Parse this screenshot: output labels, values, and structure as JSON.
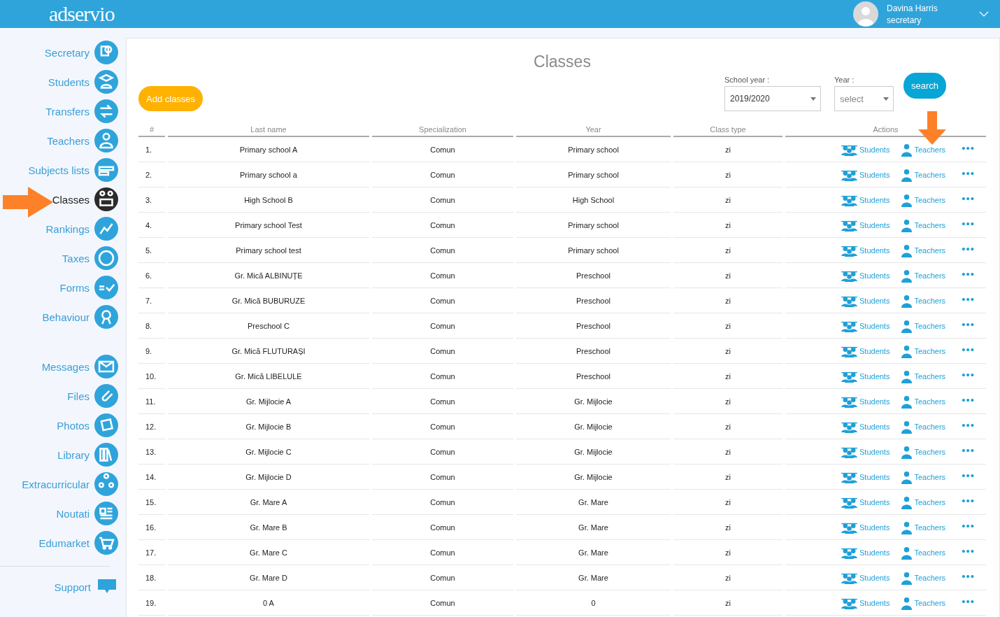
{
  "header": {
    "logo": "adservio",
    "user": {
      "name": "Davina Harris",
      "role": "secretary"
    }
  },
  "sidebar": {
    "groups": [
      [
        {
          "label": "Secretary",
          "selected": false
        },
        {
          "label": "Students",
          "selected": false
        },
        {
          "label": "Transfers",
          "selected": false
        },
        {
          "label": "Teachers",
          "selected": false
        },
        {
          "label": "Subjects lists",
          "selected": false
        },
        {
          "label": "Classes",
          "selected": true
        },
        {
          "label": "Rankings",
          "selected": false
        },
        {
          "label": "Taxes",
          "selected": false
        },
        {
          "label": "Forms",
          "selected": false
        },
        {
          "label": "Behaviour",
          "selected": false
        }
      ],
      [
        {
          "label": "Messages",
          "selected": false
        },
        {
          "label": "Files",
          "selected": false
        },
        {
          "label": "Photos",
          "selected": false
        },
        {
          "label": "Library",
          "selected": false
        },
        {
          "label": "Extracurricular",
          "selected": false
        },
        {
          "label": "Noutati",
          "selected": false
        },
        {
          "label": "Edumarket",
          "selected": false
        }
      ]
    ],
    "support": "Support"
  },
  "page": {
    "title": "Classes",
    "add_button": "Add classes",
    "filters": [
      {
        "label": "School year :",
        "value": "2019/2020"
      },
      {
        "label": "Year :",
        "placeholder": "select"
      }
    ],
    "search_button": "search"
  },
  "table": {
    "columns": [
      "#",
      "Last name",
      "Specialization",
      "Year",
      "Class type",
      "Actions"
    ],
    "rows": [
      {
        "cells": [
          "1.",
          "Primary school A",
          "Comun",
          "Primary school",
          "zi"
        ],
        "actions": [
          "Students",
          "Teachers",
          "•••"
        ]
      },
      {
        "cells": [
          "2.",
          "Primary school a",
          "Comun",
          "Primary school",
          "zi"
        ],
        "actions": [
          "Students",
          "Teachers",
          "•••"
        ]
      },
      {
        "cells": [
          "3.",
          "High School B",
          "Comun",
          "High School",
          "zi"
        ],
        "actions": [
          "Students",
          "Teachers",
          "•••"
        ]
      },
      {
        "cells": [
          "4.",
          "Primary school Test",
          "Comun",
          "Primary school",
          "zi"
        ],
        "actions": [
          "Students",
          "Teachers",
          "•••"
        ]
      },
      {
        "cells": [
          "5.",
          "Primary school test",
          "Comun",
          "Primary school",
          "zi"
        ],
        "actions": [
          "Students",
          "Teachers",
          "•••"
        ]
      },
      {
        "cells": [
          "6.",
          "Gr. Mică ALBINUȚE",
          "Comun",
          "Preschool",
          "zi"
        ],
        "actions": [
          "Students",
          "Teachers",
          "•••"
        ]
      },
      {
        "cells": [
          "7.",
          "Gr. Mică BUBURUZE",
          "Comun",
          "Preschool",
          "zi"
        ],
        "actions": [
          "Students",
          "Teachers",
          "•••"
        ]
      },
      {
        "cells": [
          "8.",
          "Preschool C",
          "Comun",
          "Preschool",
          "zi"
        ],
        "actions": [
          "Students",
          "Teachers",
          "•••"
        ]
      },
      {
        "cells": [
          "9.",
          "Gr. Mică FLUTURAȘI",
          "Comun",
          "Preschool",
          "zi"
        ],
        "actions": [
          "Students",
          "Teachers",
          "•••"
        ]
      },
      {
        "cells": [
          "10.",
          "Gr. Mică LIBELULE",
          "Comun",
          "Preschool",
          "zi"
        ],
        "actions": [
          "Students",
          "Teachers",
          "•••"
        ]
      },
      {
        "cells": [
          "11.",
          "Gr. Mijlocie A",
          "Comun",
          "Gr. Mijlocie",
          "zi"
        ],
        "actions": [
          "Students",
          "Teachers",
          "•••"
        ]
      },
      {
        "cells": [
          "12.",
          "Gr. Mijlocie B",
          "Comun",
          "Gr. Mijlocie",
          "zi"
        ],
        "actions": [
          "Students",
          "Teachers",
          "•••"
        ]
      },
      {
        "cells": [
          "13.",
          "Gr. Mijlocie C",
          "Comun",
          "Gr. Mijlocie",
          "zi"
        ],
        "actions": [
          "Students",
          "Teachers",
          "•••"
        ]
      },
      {
        "cells": [
          "14.",
          "Gr. Mijlocie D",
          "Comun",
          "Gr. Mijlocie",
          "zi"
        ],
        "actions": [
          "Students",
          "Teachers",
          "•••"
        ]
      },
      {
        "cells": [
          "15.",
          "Gr. Mare A",
          "Comun",
          "Gr. Mare",
          "zi"
        ],
        "actions": [
          "Students",
          "Teachers",
          "•••"
        ]
      },
      {
        "cells": [
          "16.",
          "Gr. Mare B",
          "Comun",
          "Gr. Mare",
          "zi"
        ],
        "actions": [
          "Students",
          "Teachers",
          "•••"
        ]
      },
      {
        "cells": [
          "17.",
          "Gr. Mare C",
          "Comun",
          "Gr. Mare",
          "zi"
        ],
        "actions": [
          "Students",
          "Teachers",
          "•••"
        ]
      },
      {
        "cells": [
          "18.",
          "Gr. Mare D",
          "Comun",
          "Gr. Mare",
          "zi"
        ],
        "actions": [
          "Students",
          "Teachers",
          "•••"
        ]
      },
      {
        "cells": [
          "19.",
          "0 A",
          "Comun",
          "0",
          "zi"
        ],
        "actions": [
          "Students",
          "Teachers",
          "•••"
        ]
      }
    ]
  }
}
